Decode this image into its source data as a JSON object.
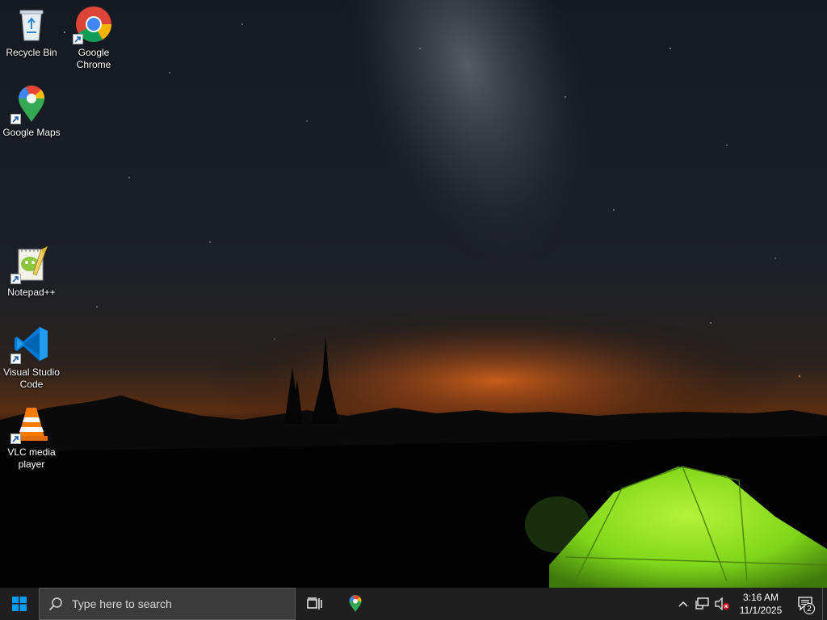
{
  "desktop": {
    "icons": [
      {
        "label": "Recycle Bin"
      },
      {
        "label": "Google Chrome"
      },
      {
        "label": "Google Maps"
      },
      {
        "label": "Notepad++"
      },
      {
        "label": "Visual Studio Code"
      },
      {
        "label": "VLC media player"
      }
    ]
  },
  "taskbar": {
    "search_placeholder": "Type here to search",
    "pinned": [
      "task-view-icon",
      "google-maps-icon"
    ],
    "tray": {
      "icons": [
        "chevron-up-icon",
        "network-icon",
        "volume-muted-icon"
      ],
      "time": "3:16 AM",
      "date": "11/1/2025",
      "notification_count": "2"
    }
  },
  "colors": {
    "taskbar_bg": "#1f1f1f",
    "search_bg": "#3b3b3b",
    "accent_blue": "#0078d7",
    "tent_green": "#7fd61a",
    "horizon_orange": "#e0661a"
  }
}
